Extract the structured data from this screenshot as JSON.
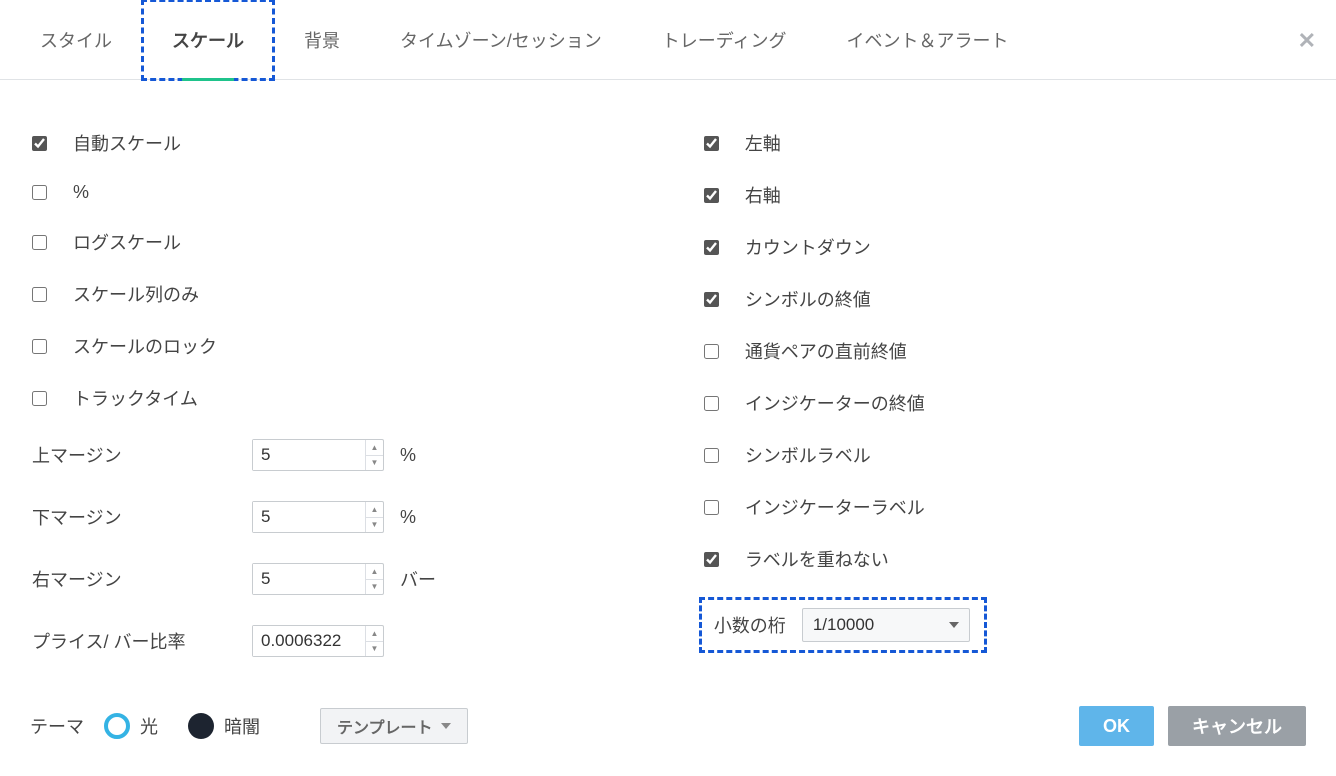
{
  "tabs": {
    "style": "スタイル",
    "scale": "スケール",
    "background": "背景",
    "timezone": "タイムゾーン/セッション",
    "trading": "トレーディング",
    "events": "イベント＆アラート"
  },
  "left": {
    "auto_scale": "自動スケール",
    "percent": "%",
    "log_scale": "ログスケール",
    "scale_series_only": "スケール列のみ",
    "lock_scale": "スケールのロック",
    "track_time": "トラックタイム",
    "top_margin_label": "上マージン",
    "top_margin_value": "5",
    "top_margin_unit": "%",
    "bottom_margin_label": "下マージン",
    "bottom_margin_value": "5",
    "bottom_margin_unit": "%",
    "right_margin_label": "右マージン",
    "right_margin_value": "5",
    "right_margin_unit": "バー",
    "price_bar_label": "プライス/ バー比率",
    "price_bar_value": "0.0006322"
  },
  "right": {
    "left_axis": "左軸",
    "right_axis": "右軸",
    "countdown": "カウントダウン",
    "symbol_last": "シンボルの終値",
    "pair_prev_close": "通貨ペアの直前終値",
    "indicator_last": "インジケーターの終値",
    "symbol_label": "シンボルラベル",
    "indicator_label": "インジケーターラベル",
    "no_overlap": "ラベルを重ねない",
    "decimal_label": "小数の桁",
    "decimal_value": "1/10000"
  },
  "footer": {
    "theme": "テーマ",
    "light": "光",
    "dark": "暗闇",
    "template": "テンプレート",
    "ok": "OK",
    "cancel": "キャンセル"
  }
}
